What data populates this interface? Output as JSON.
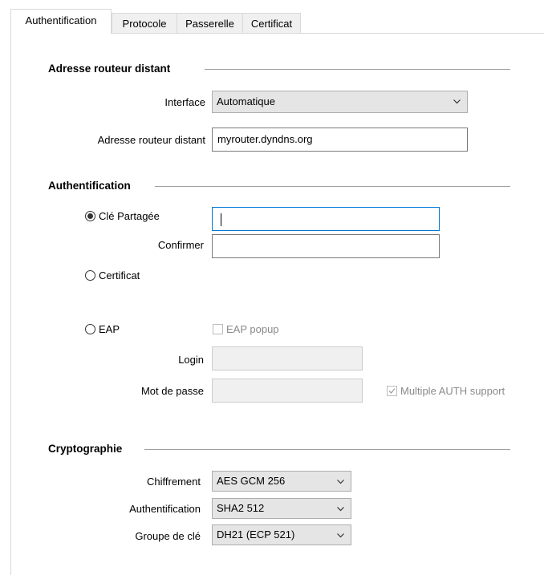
{
  "tabs": [
    {
      "label": "Authentification",
      "active": true
    },
    {
      "label": "Protocole",
      "active": false
    },
    {
      "label": "Passerelle",
      "active": false
    },
    {
      "label": "Certificat",
      "active": false
    }
  ],
  "remote_router": {
    "title": "Adresse routeur distant",
    "interface_label": "Interface",
    "interface_value": "Automatique",
    "address_label": "Adresse routeur distant",
    "address_value": "myrouter.dyndns.org"
  },
  "authentication": {
    "title": "Authentification",
    "preshared_label": "Clé Partagée",
    "preshared_selected": true,
    "confirm_label": "Confirmer",
    "certificate_label": "Certificat",
    "eap_label": "EAP",
    "eap_popup_label": "EAP popup",
    "login_label": "Login",
    "password_label": "Mot de passe",
    "multiple_auth_label": "Multiple AUTH support",
    "multiple_auth_checked": true
  },
  "crypto": {
    "title": "Cryptographie",
    "cipher_label": "Chiffrement",
    "cipher_value": "AES GCM 256",
    "auth_label": "Authentification",
    "auth_value": "SHA2 512",
    "keygroup_label": "Groupe de clé",
    "keygroup_value": "DH21 (ECP 521)"
  },
  "colors": {
    "focus_border": "#0078d7",
    "disabled_bg": "#f0f0f0"
  }
}
